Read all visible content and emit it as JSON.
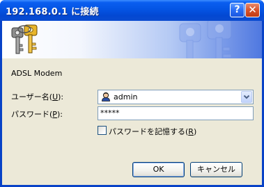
{
  "window": {
    "title": "192.168.0.1 に接続",
    "help_glyph": "?",
    "close_glyph": "✕"
  },
  "banner": {
    "icon": "keys-icon"
  },
  "realm": "ADSL Modem",
  "username": {
    "label_prefix": "ユーザー名(",
    "label_access": "U",
    "label_suffix": "):",
    "value": "admin",
    "icon": "user-icon"
  },
  "password": {
    "label_prefix": "パスワード(",
    "label_access": "P",
    "label_suffix": "):",
    "value": "*****"
  },
  "remember": {
    "label_prefix": "パスワードを記憶する(",
    "label_access": "R",
    "label_suffix": ")",
    "checked": false
  },
  "buttons": {
    "ok": "OK",
    "cancel": "キャンセル"
  },
  "colors": {
    "titlebar": "#0454e3",
    "client": "#ece9d8",
    "close": "#d8522a"
  }
}
